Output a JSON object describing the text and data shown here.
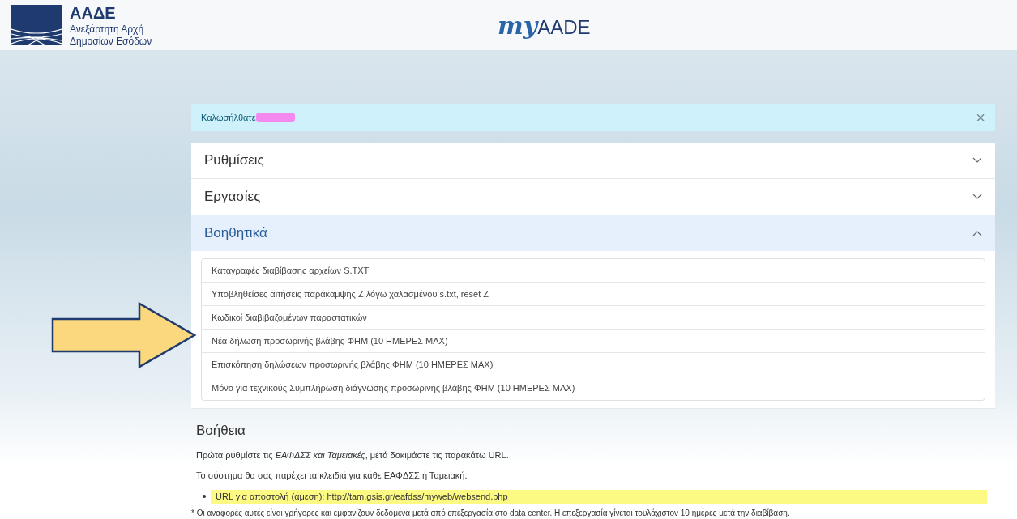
{
  "header": {
    "logo_title": "ΑΑΔΕ",
    "logo_subtitle_1": "Ανεξάρτητη Αρχή",
    "logo_subtitle_2": "Δημοσίων Εσόδων",
    "brand_prefix": "my",
    "brand_suffix": "AADE"
  },
  "alert": {
    "text": "Καλωσήλθατε",
    "close": "×"
  },
  "accordion": [
    {
      "title": "Ρυθμίσεις",
      "expanded": false
    },
    {
      "title": "Εργασίες",
      "expanded": false
    },
    {
      "title": "Βοηθητικά",
      "expanded": true,
      "children": [
        "Καταγραφές διαβίβασης αρχείων S.TXT",
        "Υποβληθείσες αιτήσεις παράκαμψης Z λόγω χαλασμένου s.txt, reset Z",
        "Κωδικοί διαβιβαζομένων παραστατικών",
        "Νέα δήλωση προσωρινής βλάβης ΦΗΜ (10 ΗΜΕΡΕΣ MAX)",
        "Επισκόπηση δηλώσεων προσωρινής βλάβης ΦΗΜ (10 ΗΜΕΡΕΣ MAX)",
        "Μόνο για τεχνικούς:Συμπλήρωση διάγνωσης προσωρινής βλάβης ΦΗΜ (10 ΗΜΕΡΕΣ MAX)"
      ]
    }
  ],
  "help": {
    "title": "Βοήθεια",
    "paragraphs": [
      "Πρώτα ρυθμίστε τις *ΕΑΦΔΣΣ και Ταμειακές*, μετά δοκιμάστε τις παρακάτω URL.",
      "Το σύστημα θα σας παρέχει τα κλειδιά για κάθε ΕΑΦΔΣΣ ή Ταμειακή."
    ],
    "bullets": [
      "URL για αποστολή (άμεση): http://tam.gsis.gr/eafdss/myweb/websend.php"
    ],
    "footnote": "* Οι αναφορές αυτές είναι γρήγορες και εμφανίζουν δεδομένα μετά από επεξεργασία στο data center. Η επεξεργασία γίνεται τουλάχιστον 10 ημέρες μετά την διαβίβαση."
  }
}
